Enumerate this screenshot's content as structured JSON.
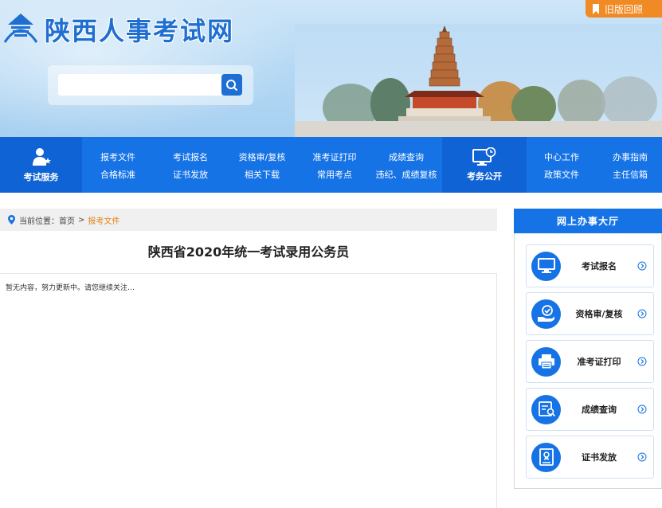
{
  "header": {
    "site_title": "陕西人事考试网",
    "old_version_label": "旧版回顾",
    "search_placeholder": ""
  },
  "nav": {
    "exam_service": "考试服务",
    "exam_public": "考务公开",
    "group1": [
      "报考文件",
      "合格标准",
      "考试报名",
      "证书发放",
      "资格审/复核",
      "相关下载",
      "准考证打印",
      "常用考点",
      "成绩查询",
      "违纪、成绩复核"
    ],
    "group2": [
      "中心工作",
      "政策文件",
      "办事指南",
      "主任信箱"
    ]
  },
  "breadcrumb": {
    "prefix": "当前位置：",
    "home": "首页",
    "separator": ">",
    "current": "报考文件"
  },
  "article": {
    "title": "陕西省2020年统一考试录用公务员",
    "body": "暂无内容，努力更新中。请您继续关注…"
  },
  "side": {
    "title": "网上办事大厅",
    "items": [
      {
        "label": "考试报名",
        "icon": "monitor-icon"
      },
      {
        "label": "资格审/复核",
        "icon": "hand-check-icon"
      },
      {
        "label": "准考证打印",
        "icon": "printer-icon"
      },
      {
        "label": "成绩查询",
        "icon": "search-document-icon"
      },
      {
        "label": "证书发放",
        "icon": "certificate-icon"
      }
    ]
  },
  "colors": {
    "primary": "#1673e6",
    "accent": "#f08a24",
    "title_blue": "#1f6fd1"
  }
}
